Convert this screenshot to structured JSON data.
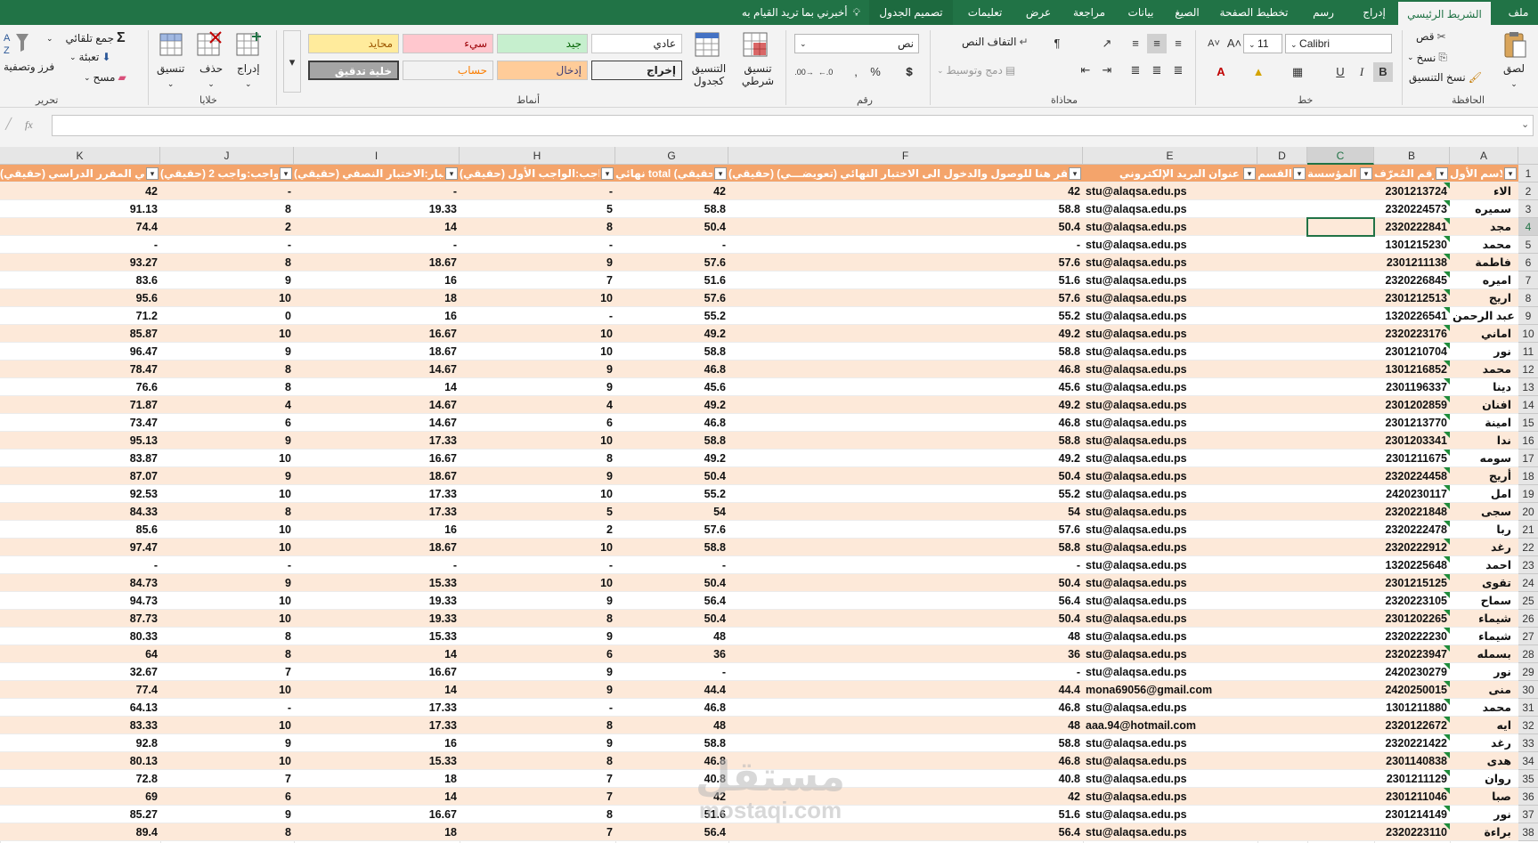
{
  "tabs": [
    {
      "label": "ملف",
      "name": "file"
    },
    {
      "label": "الشريط الرئيسي",
      "name": "home",
      "active": true
    },
    {
      "label": "إدراج",
      "name": "insert"
    },
    {
      "label": "رسم",
      "name": "draw"
    },
    {
      "label": "تخطيط الصفحة",
      "name": "page-layout"
    },
    {
      "label": "الصيغ",
      "name": "formulas"
    },
    {
      "label": "بيانات",
      "name": "data"
    },
    {
      "label": "مراجعة",
      "name": "review"
    },
    {
      "label": "عرض",
      "name": "view"
    },
    {
      "label": "تعليمات",
      "name": "help"
    },
    {
      "label": "تصميم الجدول",
      "name": "table-design"
    }
  ],
  "tell_me": "أخبرني بما تريد القيام به",
  "ribbon": {
    "clipboard": {
      "paste": "لصق",
      "cut": "قص",
      "copy": "نسخ",
      "format_painter": "نسخ التنسيق",
      "label": "الحافظة"
    },
    "font": {
      "family": "Calibri",
      "size": "11",
      "label": "خط"
    },
    "alignment": {
      "wrap": "التفاف النص",
      "merge": "دمج وتوسيط",
      "label": "محاذاة"
    },
    "number": {
      "format": "نص",
      "label": "رقم"
    },
    "styles": {
      "conditional": "تنسيق شرطي",
      "as_table": "التنسيق كجدول",
      "normal": "عادي",
      "bad": "سيء",
      "good": "جيد",
      "neutral": "محايد",
      "output": "إخراج",
      "input": "إدخال",
      "calculation": "حساب",
      "check_cell": "خلية تدقيق",
      "label": "أنماط"
    },
    "cells": {
      "insert": "إدراج",
      "delete": "حذف",
      "format": "تنسيق",
      "label": "خلايا"
    },
    "editing": {
      "autosum": "جمع تلقائي",
      "fill": "تعبئة",
      "clear": "مسح",
      "sort": "فرز وتصفية",
      "label": "تحرير"
    }
  },
  "formula_bar": {
    "fx": "fx",
    "value": ""
  },
  "colors": {
    "accent": "#217346",
    "header": "#f4a46b",
    "band": "#fde9d9"
  },
  "columns": [
    {
      "letter": "A",
      "header": "الاسم الأول"
    },
    {
      "letter": "B",
      "header": "رقم المُعرّف"
    },
    {
      "letter": "C",
      "header": "المؤسسة"
    },
    {
      "letter": "D",
      "header": "القسم"
    },
    {
      "letter": "E",
      "header": "عنوان البريد الإلكتروني"
    },
    {
      "letter": "F",
      "header": "اختبار:انقر هنا للوصول والدخول الى الاختبار النهائي (تعويضـــي) (حقيقي)"
    },
    {
      "letter": "G",
      "header": "نهائي total (حقيقي)"
    },
    {
      "letter": "H",
      "header": "واجب:الواجب الأول (حقيقي)"
    },
    {
      "letter": "I",
      "header": "اختبار:الاختبار النصفي (حقيقي)"
    },
    {
      "letter": "J",
      "header": "واجب:واجب 2 (حقيقي)"
    },
    {
      "letter": "K",
      "header": "إجمالي المقرر الدراسي (حقيقي)"
    }
  ],
  "rows": [
    {
      "n": "2",
      "a": "الاء",
      "b": "2301213724",
      "e": "stu@alaqsa.edu.ps",
      "f": "42",
      "g": "42",
      "h": "-",
      "i": "-",
      "j": "-",
      "k": "42"
    },
    {
      "n": "3",
      "a": "سميره",
      "b": "2320224573",
      "e": "stu@alaqsa.edu.ps",
      "f": "58.8",
      "g": "58.8",
      "h": "5",
      "i": "19.33",
      "j": "8",
      "k": "91.13"
    },
    {
      "n": "4",
      "a": "مجد",
      "b": "2320222841",
      "e": "stu@alaqsa.edu.ps",
      "f": "50.4",
      "g": "50.4",
      "h": "8",
      "i": "14",
      "j": "2",
      "k": "74.4"
    },
    {
      "n": "5",
      "a": "محمد",
      "b": "1301215230",
      "e": "stu@alaqsa.edu.ps",
      "f": "-",
      "g": "-",
      "h": "-",
      "i": "-",
      "j": "-",
      "k": "-"
    },
    {
      "n": "6",
      "a": "فاطمة",
      "b": "2301211138",
      "e": "stu@alaqsa.edu.ps",
      "f": "57.6",
      "g": "57.6",
      "h": "9",
      "i": "18.67",
      "j": "8",
      "k": "93.27"
    },
    {
      "n": "7",
      "a": "اميره",
      "b": "2320226845",
      "e": "stu@alaqsa.edu.ps",
      "f": "51.6",
      "g": "51.6",
      "h": "7",
      "i": "16",
      "j": "9",
      "k": "83.6"
    },
    {
      "n": "8",
      "a": "اريج",
      "b": "2301212513",
      "e": "stu@alaqsa.edu.ps",
      "f": "57.6",
      "g": "57.6",
      "h": "10",
      "i": "18",
      "j": "10",
      "k": "95.6"
    },
    {
      "n": "9",
      "a": "عبد الرحمن",
      "b": "1320226541",
      "e": "stu@alaqsa.edu.ps",
      "f": "55.2",
      "g": "55.2",
      "h": "-",
      "i": "16",
      "j": "0",
      "k": "71.2"
    },
    {
      "n": "10",
      "a": "اماني",
      "b": "2320223176",
      "e": "stu@alaqsa.edu.ps",
      "f": "49.2",
      "g": "49.2",
      "h": "10",
      "i": "16.67",
      "j": "10",
      "k": "85.87"
    },
    {
      "n": "11",
      "a": "نور",
      "b": "2301210704",
      "e": "stu@alaqsa.edu.ps",
      "f": "58.8",
      "g": "58.8",
      "h": "10",
      "i": "18.67",
      "j": "9",
      "k": "96.47"
    },
    {
      "n": "12",
      "a": "محمد",
      "b": "1301216852",
      "e": "stu@alaqsa.edu.ps",
      "f": "46.8",
      "g": "46.8",
      "h": "9",
      "i": "14.67",
      "j": "8",
      "k": "78.47"
    },
    {
      "n": "13",
      "a": "دينا",
      "b": "2301196337",
      "e": "stu@alaqsa.edu.ps",
      "f": "45.6",
      "g": "45.6",
      "h": "9",
      "i": "14",
      "j": "8",
      "k": "76.6"
    },
    {
      "n": "14",
      "a": "افنان",
      "b": "2301202859",
      "e": "stu@alaqsa.edu.ps",
      "f": "49.2",
      "g": "49.2",
      "h": "4",
      "i": "14.67",
      "j": "4",
      "k": "71.87"
    },
    {
      "n": "15",
      "a": "امينة",
      "b": "2301213770",
      "e": "stu@alaqsa.edu.ps",
      "f": "46.8",
      "g": "46.8",
      "h": "6",
      "i": "14.67",
      "j": "6",
      "k": "73.47"
    },
    {
      "n": "16",
      "a": "ندا",
      "b": "2301203341",
      "e": "stu@alaqsa.edu.ps",
      "f": "58.8",
      "g": "58.8",
      "h": "10",
      "i": "17.33",
      "j": "9",
      "k": "95.13"
    },
    {
      "n": "17",
      "a": "سومه",
      "b": "2301211675",
      "e": "stu@alaqsa.edu.ps",
      "f": "49.2",
      "g": "49.2",
      "h": "8",
      "i": "16.67",
      "j": "10",
      "k": "83.87"
    },
    {
      "n": "18",
      "a": "أريج",
      "b": "2320224458",
      "e": "stu@alaqsa.edu.ps",
      "f": "50.4",
      "g": "50.4",
      "h": "9",
      "i": "18.67",
      "j": "9",
      "k": "87.07"
    },
    {
      "n": "19",
      "a": "امل",
      "b": "2420230117",
      "e": "stu@alaqsa.edu.ps",
      "f": "55.2",
      "g": "55.2",
      "h": "10",
      "i": "17.33",
      "j": "10",
      "k": "92.53"
    },
    {
      "n": "20",
      "a": "سجى",
      "b": "2320221848",
      "e": "stu@alaqsa.edu.ps",
      "f": "54",
      "g": "54",
      "h": "5",
      "i": "17.33",
      "j": "8",
      "k": "84.33"
    },
    {
      "n": "21",
      "a": "ربا",
      "b": "2320222478",
      "e": "stu@alaqsa.edu.ps",
      "f": "57.6",
      "g": "57.6",
      "h": "2",
      "i": "16",
      "j": "10",
      "k": "85.6"
    },
    {
      "n": "22",
      "a": "رغد",
      "b": "2320222912",
      "e": "stu@alaqsa.edu.ps",
      "f": "58.8",
      "g": "58.8",
      "h": "10",
      "i": "18.67",
      "j": "10",
      "k": "97.47"
    },
    {
      "n": "23",
      "a": "احمد",
      "b": "1320225648",
      "e": "stu@alaqsa.edu.ps",
      "f": "-",
      "g": "-",
      "h": "-",
      "i": "-",
      "j": "-",
      "k": "-"
    },
    {
      "n": "24",
      "a": "تقوى",
      "b": "2301215125",
      "e": "stu@alaqsa.edu.ps",
      "f": "50.4",
      "g": "50.4",
      "h": "10",
      "i": "15.33",
      "j": "9",
      "k": "84.73"
    },
    {
      "n": "25",
      "a": "سماح",
      "b": "2320223105",
      "e": "stu@alaqsa.edu.ps",
      "f": "56.4",
      "g": "56.4",
      "h": "9",
      "i": "19.33",
      "j": "10",
      "k": "94.73"
    },
    {
      "n": "26",
      "a": "شيماء",
      "b": "2301202265",
      "e": "stu@alaqsa.edu.ps",
      "f": "50.4",
      "g": "50.4",
      "h": "8",
      "i": "19.33",
      "j": "10",
      "k": "87.73"
    },
    {
      "n": "27",
      "a": "شيماء",
      "b": "2320222230",
      "e": "stu@alaqsa.edu.ps",
      "f": "48",
      "g": "48",
      "h": "9",
      "i": "15.33",
      "j": "8",
      "k": "80.33"
    },
    {
      "n": "28",
      "a": "بسمله",
      "b": "2320223947",
      "e": "stu@alaqsa.edu.ps",
      "f": "36",
      "g": "36",
      "h": "6",
      "i": "14",
      "j": "8",
      "k": "64"
    },
    {
      "n": "29",
      "a": "نور",
      "b": "2420230279",
      "e": "stu@alaqsa.edu.ps",
      "f": "-",
      "g": "-",
      "h": "9",
      "i": "16.67",
      "j": "7",
      "k": "32.67"
    },
    {
      "n": "30",
      "a": "منى",
      "b": "2420250015",
      "e": "mona69056@gmail.com",
      "f": "44.4",
      "g": "44.4",
      "h": "9",
      "i": "14",
      "j": "10",
      "k": "77.4"
    },
    {
      "n": "31",
      "a": "محمد",
      "b": "1301211880",
      "e": "stu@alaqsa.edu.ps",
      "f": "46.8",
      "g": "46.8",
      "h": "-",
      "i": "17.33",
      "j": "-",
      "k": "64.13"
    },
    {
      "n": "32",
      "a": "ايه",
      "b": "2320122672",
      "e": "aaa.94@hotmail.com",
      "f": "48",
      "g": "48",
      "h": "8",
      "i": "17.33",
      "j": "10",
      "k": "83.33"
    },
    {
      "n": "33",
      "a": "رغد",
      "b": "2320221422",
      "e": "stu@alaqsa.edu.ps",
      "f": "58.8",
      "g": "58.8",
      "h": "9",
      "i": "16",
      "j": "9",
      "k": "92.8"
    },
    {
      "n": "34",
      "a": "هدى",
      "b": "2301140838",
      "e": "stu@alaqsa.edu.ps",
      "f": "46.8",
      "g": "46.8",
      "h": "8",
      "i": "15.33",
      "j": "10",
      "k": "80.13"
    },
    {
      "n": "35",
      "a": "روان",
      "b": "2301211129",
      "e": "stu@alaqsa.edu.ps",
      "f": "40.8",
      "g": "40.8",
      "h": "7",
      "i": "18",
      "j": "7",
      "k": "72.8"
    },
    {
      "n": "36",
      "a": "صبا",
      "b": "2301211046",
      "e": "stu@alaqsa.edu.ps",
      "f": "42",
      "g": "42",
      "h": "7",
      "i": "14",
      "j": "6",
      "k": "69"
    },
    {
      "n": "37",
      "a": "نور",
      "b": "2301214149",
      "e": "stu@alaqsa.edu.ps",
      "f": "51.6",
      "g": "51.6",
      "h": "8",
      "i": "16.67",
      "j": "9",
      "k": "85.27"
    },
    {
      "n": "38",
      "a": "براءة",
      "b": "2320223110",
      "e": "stu@alaqsa.edu.ps",
      "f": "56.4",
      "g": "56.4",
      "h": "7",
      "i": "18",
      "j": "8",
      "k": "89.4"
    }
  ],
  "watermark": {
    "arabic": "مستقل",
    "latin": "mostaqi.com"
  }
}
